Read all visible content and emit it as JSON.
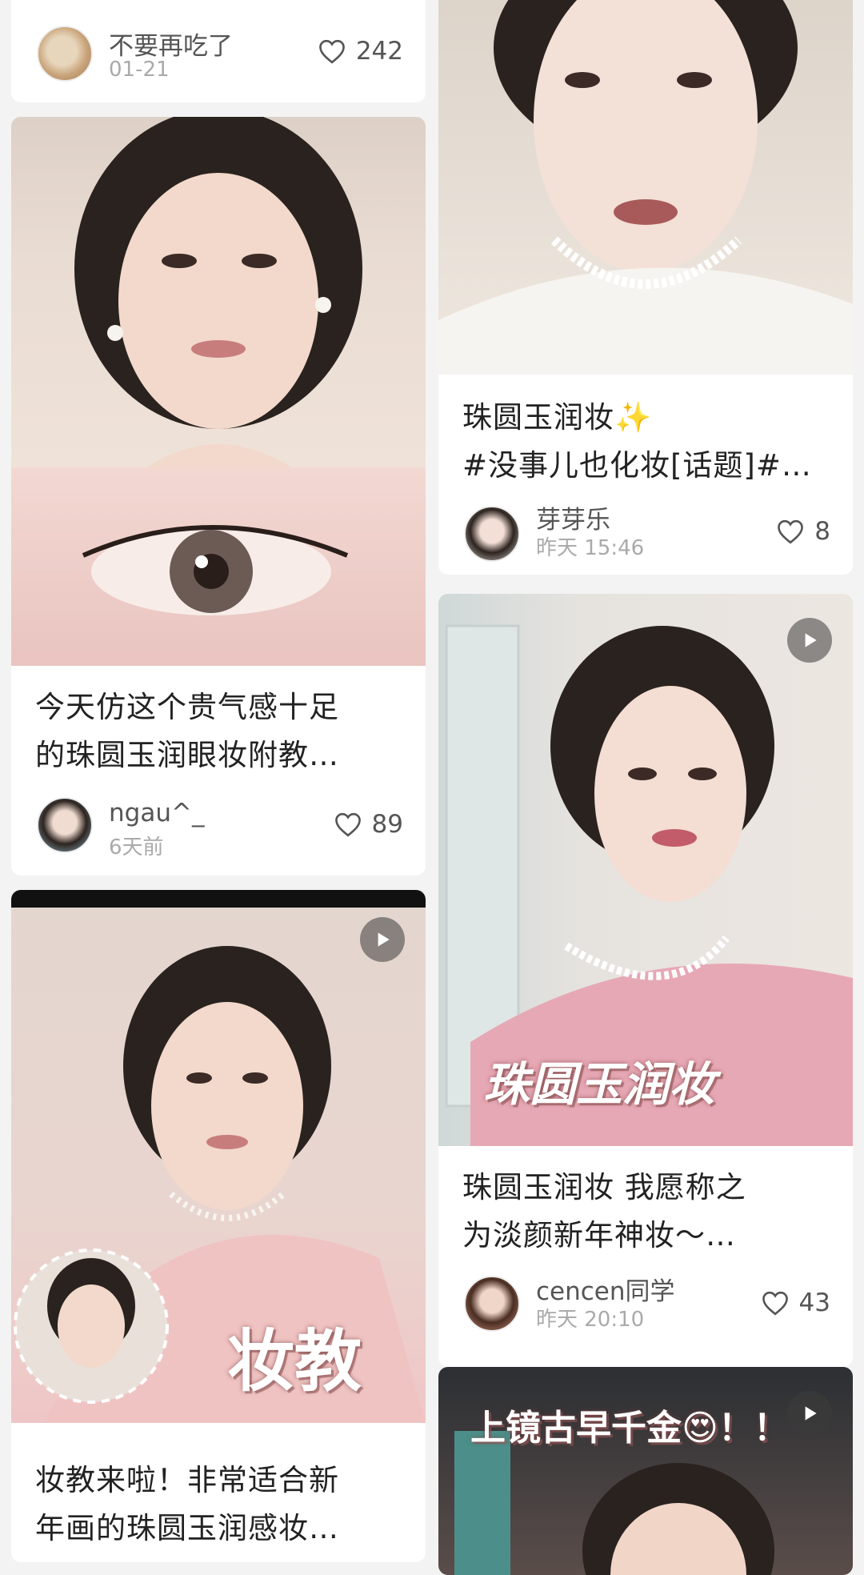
{
  "accent_color": "#e3313d",
  "icons": {
    "like": "heart-outline-icon",
    "video": "play-icon"
  },
  "cards": {
    "top_left": {
      "author": "不要再吃了",
      "time": "01-21",
      "likes": "242"
    },
    "left_1": {
      "title_line1": "今天仿这个贵气感十足",
      "title_line2": "的珠圆玉润眼妆附教…",
      "author": "ngau^_",
      "time": "6天前",
      "likes": "89"
    },
    "left_2": {
      "overlay": "妆教",
      "title_line1": "妆教来啦！非常适合新",
      "title_line2": "年画的珠圆玉润感妆…"
    },
    "right_1": {
      "title_line1": "珠圆玉润妆✨",
      "title_line2": "#没事儿也化妆[话题]#…",
      "author": "芽芽乐",
      "time": "昨天 15:46",
      "likes": "8"
    },
    "right_2": {
      "overlay": "珠圆玉润妆",
      "title_line1": "珠圆玉润妆 我愿称之",
      "title_line2": "为淡颜新年神妆～…",
      "author": "cencen同学",
      "time": "昨天 20:10",
      "likes": "43"
    },
    "right_3": {
      "overlay": "上镜古早千金😍！！"
    }
  }
}
